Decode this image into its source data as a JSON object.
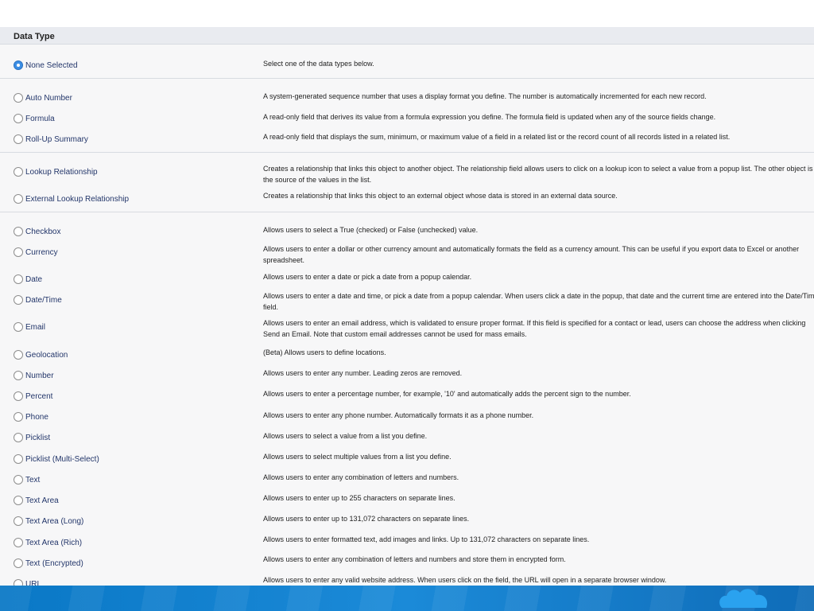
{
  "section": {
    "title": "Data Type"
  },
  "data_types": [
    {
      "label": "None Selected",
      "selected": true,
      "description": "Select one of the data types below."
    },
    {
      "label": "Auto Number",
      "selected": false,
      "description": "A system-generated sequence number that uses a display format you define. The number is automatically incremented for each new record."
    },
    {
      "label": "Formula",
      "selected": false,
      "description": "A read-only field that derives its value from a formula expression you define. The formula field is updated when any of the source fields change."
    },
    {
      "label": "Roll-Up Summary",
      "selected": false,
      "description": "A read-only field that displays the sum, minimum, or maximum value of a field in a related list or the record count of all records listed in a related list."
    },
    {
      "label": "Lookup Relationship",
      "selected": false,
      "description": "Creates a relationship that links this object to another object. The relationship field allows users to click on a lookup icon to select a value from a popup list. The other object is the source of the values in the list."
    },
    {
      "label": "External Lookup Relationship",
      "selected": false,
      "description": "Creates a relationship that links this object to an external object whose data is stored in an external data source."
    },
    {
      "label": "Checkbox",
      "selected": false,
      "description": "Allows users to select a True (checked) or False (unchecked) value."
    },
    {
      "label": "Currency",
      "selected": false,
      "description": "Allows users to enter a dollar or other currency amount and automatically formats the field as a currency amount. This can be useful if you export data to Excel or another spreadsheet."
    },
    {
      "label": "Date",
      "selected": false,
      "description": "Allows users to enter a date or pick a date from a popup calendar."
    },
    {
      "label": "Date/Time",
      "selected": false,
      "description": "Allows users to enter a date and time, or pick a date from a popup calendar. When users click a date in the popup, that date and the current time are entered into the Date/Time field."
    },
    {
      "label": "Email",
      "selected": false,
      "description": "Allows users to enter an email address, which is validated to ensure proper format. If this field is specified for a contact or lead, users can choose the address when clicking Send an Email. Note that custom email addresses cannot be used for mass emails."
    },
    {
      "label": "Geolocation",
      "selected": false,
      "description": "(Beta) Allows users to define locations."
    },
    {
      "label": "Number",
      "selected": false,
      "description": "Allows users to enter any number. Leading zeros are removed."
    },
    {
      "label": "Percent",
      "selected": false,
      "description": "Allows users to enter a percentage number, for example, '10' and automatically adds the percent sign to the number."
    },
    {
      "label": "Phone",
      "selected": false,
      "description": "Allows users to enter any phone number. Automatically formats it as a phone number."
    },
    {
      "label": "Picklist",
      "selected": false,
      "description": "Allows users to select a value from a list you define."
    },
    {
      "label": "Picklist (Multi-Select)",
      "selected": false,
      "description": "Allows users to select multiple values from a list you define."
    },
    {
      "label": "Text",
      "selected": false,
      "description": "Allows users to enter any combination of letters and numbers."
    },
    {
      "label": "Text Area",
      "selected": false,
      "description": "Allows users to enter up to 255 characters on separate lines."
    },
    {
      "label": "Text Area (Long)",
      "selected": false,
      "description": "Allows users to enter up to 131,072 characters on separate lines."
    },
    {
      "label": "Text Area (Rich)",
      "selected": false,
      "description": "Allows users to enter formatted text, add images and links. Up to 131,072 characters on separate lines."
    },
    {
      "label": "Text (Encrypted)",
      "selected": false,
      "description": "Allows users to enter any combination of letters and numbers and store them in encrypted form."
    },
    {
      "label": "URL",
      "selected": false,
      "description": "Allows users to enter any valid website address. When users click on the field, the URL will open in a separate browser window."
    }
  ],
  "theme": {
    "label_color": "#23366a",
    "radio_selected_color": "#3b8ee5",
    "footer_color": "#0a78c6",
    "logo_color": "#1da1f2"
  },
  "footer": {
    "logo_icon": "salesforce-cloud-icon"
  }
}
